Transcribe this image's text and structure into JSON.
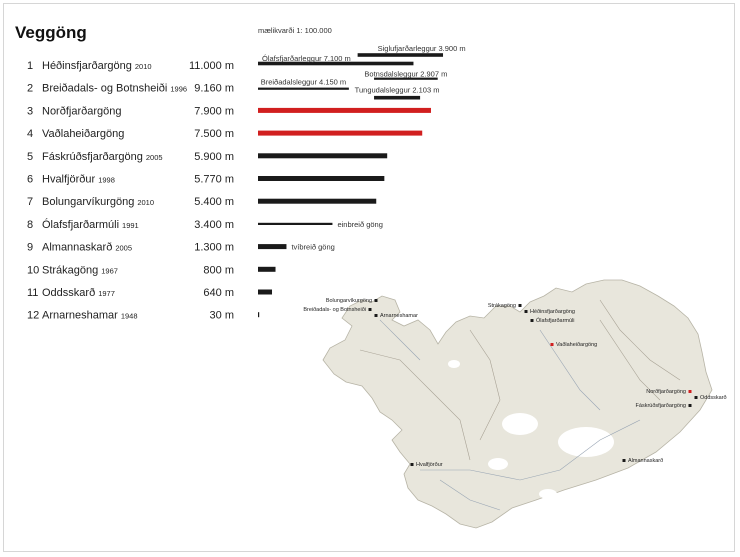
{
  "title": "Veggöng",
  "scale_label": "mælikvarði 1: 100.000",
  "colors": {
    "bar_default": "#1a1a1a",
    "bar_highlight": "#d11f1f",
    "land": "#e8e6dc",
    "land_stroke": "#b7b4a6",
    "water": "#ffffff",
    "rivers": "#9aa6b4",
    "roads": "#a8a295"
  },
  "chart_data": {
    "type": "bar",
    "orientation": "horizontal",
    "unit": "m",
    "xlim": [
      0,
      11600
    ],
    "rows": [
      {
        "rank": "1",
        "name": "Héðinsfjarðargöng",
        "year": "2010",
        "length_label": "11.000 m",
        "value": 11000,
        "color": "#1a1a1a",
        "thin": false
      },
      {
        "rank": "2",
        "name": "Breiðadals- og Botnsheiði",
        "year": "1996",
        "length_label": "9.160 m",
        "value": 9160,
        "color": "#1a1a1a",
        "thin": true
      },
      {
        "rank": "3",
        "name": "Norðfjarðargöng",
        "year": "",
        "length_label": "7.900 m",
        "value": 7900,
        "color": "#d11f1f",
        "thin": false
      },
      {
        "rank": "4",
        "name": "Vaðlaheiðargöng",
        "year": "",
        "length_label": "7.500 m",
        "value": 7500,
        "color": "#d11f1f",
        "thin": false
      },
      {
        "rank": "5",
        "name": "Fáskrúðsfjarðargöng",
        "year": "2005",
        "length_label": "5.900 m",
        "value": 5900,
        "color": "#1a1a1a",
        "thin": false
      },
      {
        "rank": "6",
        "name": "Hvalfjörður",
        "year": "1998",
        "length_label": "5.770 m",
        "value": 5770,
        "color": "#1a1a1a",
        "thin": false
      },
      {
        "rank": "7",
        "name": "Bolungarvíkurgöng",
        "year": "2010",
        "length_label": "5.400 m",
        "value": 5400,
        "color": "#1a1a1a",
        "thin": false
      },
      {
        "rank": "8",
        "name": "Ólafsfjarðarmúli",
        "year": "1991",
        "length_label": "3.400 m",
        "value": 3400,
        "color": "#1a1a1a",
        "thin": true
      },
      {
        "rank": "9",
        "name": "Almannaskarð",
        "year": "2005",
        "length_label": "1.300 m",
        "value": 1300,
        "color": "#1a1a1a",
        "thin": false
      },
      {
        "rank": "10",
        "name": "Strákagöng",
        "year": "1967",
        "length_label": "800 m",
        "value": 800,
        "color": "#1a1a1a",
        "thin": false
      },
      {
        "rank": "11",
        "name": "Oddsskarð",
        "year": "1977",
        "length_label": "640 m",
        "value": 640,
        "color": "#1a1a1a",
        "thin": false
      },
      {
        "rank": "12",
        "name": "Arnarneshamar",
        "year": "1948",
        "length_label": "30 m",
        "value": 30,
        "color": "#1a1a1a",
        "thin": false
      }
    ],
    "segments": [
      {
        "label": "Siglufjarðarleggur 3.900 m",
        "row": "1",
        "start": 4550,
        "end": 8450
      },
      {
        "label": "Ólafsfjarðarleggur 7.100 m",
        "row": "1",
        "start": 0,
        "end": 7100
      },
      {
        "label": "Botnsdalsleggur 2.907 m",
        "row": "2",
        "start": 5300,
        "end": 8207
      },
      {
        "label": "Breiðadalsleggur 4.150 m",
        "row": "2",
        "start": 0,
        "end": 4150
      },
      {
        "label": "Tungudalsleggur 2.103 m",
        "row": "2",
        "start": 5300,
        "end": 7403
      }
    ],
    "annotations": [
      {
        "row": "8",
        "text": "einbreið göng"
      },
      {
        "row": "9",
        "text": "tvíbreið göng"
      }
    ]
  },
  "map_labels": [
    {
      "text": "Bolungarvíkurgöng",
      "tunnel": "7"
    },
    {
      "text": "Breiðadals- og Botnsheiði",
      "tunnel": "2"
    },
    {
      "text": "Arnarneshamar",
      "tunnel": "12"
    },
    {
      "text": "Strákagöng",
      "tunnel": "10"
    },
    {
      "text": "Héðinsfjarðargöng",
      "tunnel": "1"
    },
    {
      "text": "Ólafsfjarðarmúli",
      "tunnel": "8"
    },
    {
      "text": "Vaðlaheiðargöng",
      "tunnel": "4"
    },
    {
      "text": "Norðfjarðargöng",
      "tunnel": "3"
    },
    {
      "text": "Oddsskarð",
      "tunnel": "11"
    },
    {
      "text": "Fáskrúðsfjarðargöng",
      "tunnel": "5"
    },
    {
      "text": "Hvalfjörður",
      "tunnel": "6"
    },
    {
      "text": "Almannaskarð",
      "tunnel": "9"
    }
  ]
}
